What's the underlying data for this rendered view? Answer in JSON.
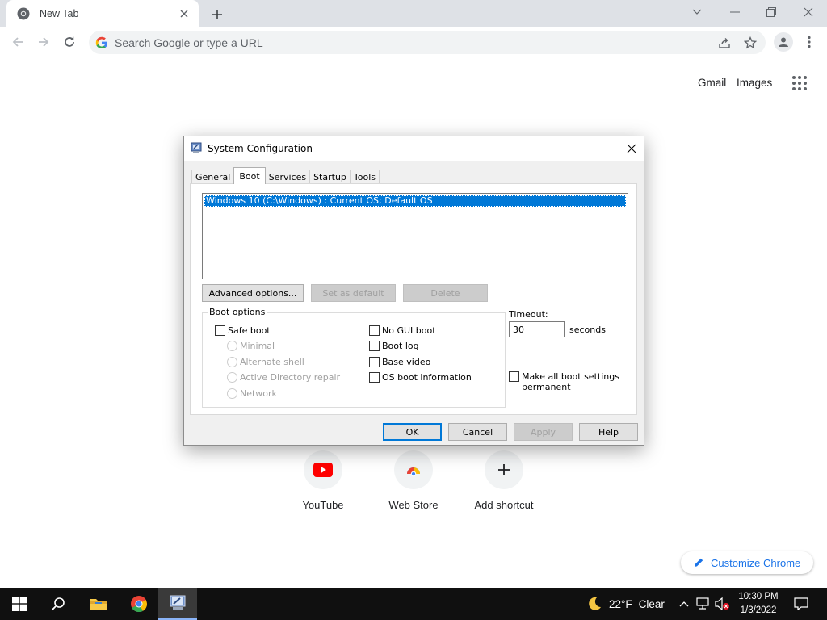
{
  "browser": {
    "tab_title": "New Tab",
    "omnibox_placeholder": "Search Google or type a URL"
  },
  "ntp": {
    "gmail": "Gmail",
    "images": "Images",
    "shortcuts": [
      {
        "label": "YouTube",
        "icon": "youtube-icon"
      },
      {
        "label": "Web Store",
        "icon": "web-store-icon"
      },
      {
        "label": "Add shortcut",
        "icon": "plus-icon"
      }
    ],
    "customize": "Customize Chrome"
  },
  "dialog": {
    "title": "System Configuration",
    "tabs": [
      "General",
      "Boot",
      "Services",
      "Startup",
      "Tools"
    ],
    "active_tab": "Boot",
    "os_entries": [
      "Windows 10 (C:\\Windows) : Current OS; Default OS"
    ],
    "buttons": {
      "advanced": "Advanced options...",
      "set_default": "Set as default",
      "delete": "Delete"
    },
    "boot_options": {
      "legend": "Boot options",
      "safe_boot": {
        "label": "Safe boot",
        "checked": false
      },
      "safe_modes": [
        {
          "label": "Minimal",
          "enabled": false
        },
        {
          "label": "Alternate shell",
          "enabled": false
        },
        {
          "label": "Active Directory repair",
          "enabled": false
        },
        {
          "label": "Network",
          "enabled": false
        }
      ],
      "right_options": [
        {
          "label": "No GUI boot",
          "checked": false
        },
        {
          "label": "Boot log",
          "checked": false
        },
        {
          "label": "Base video",
          "checked": false
        },
        {
          "label": "OS boot information",
          "checked": false
        }
      ]
    },
    "timeout": {
      "label": "Timeout:",
      "value": "30",
      "unit": "seconds"
    },
    "make_permanent": {
      "line1": "Make all boot settings",
      "line2": "permanent",
      "checked": false
    },
    "footer": {
      "ok": "OK",
      "cancel": "Cancel",
      "apply": "Apply",
      "help": "Help"
    }
  },
  "taskbar": {
    "weather_temp": "22°F",
    "weather_desc": "Clear",
    "time": "10:30 PM",
    "date": "1/3/2022"
  },
  "colors": {
    "selection": "#0078d7",
    "chrome_frame": "#dee1e6",
    "link_blue": "#1a73e8",
    "taskbar": "#101010"
  }
}
